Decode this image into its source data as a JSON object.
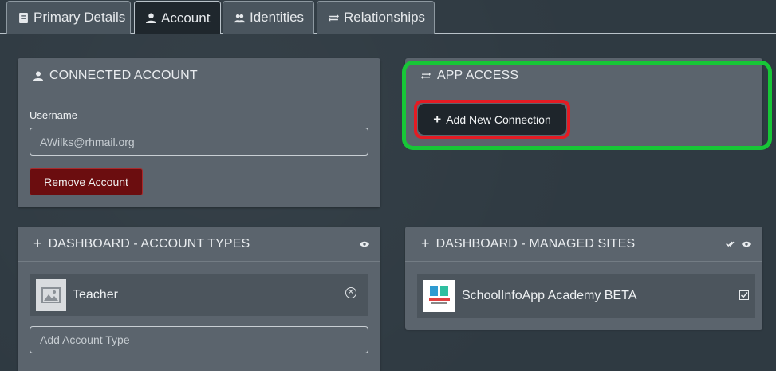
{
  "tabs": [
    {
      "label": "Primary Details",
      "icon": "document-icon"
    },
    {
      "label": "Account",
      "icon": "user-icon"
    },
    {
      "label": "Identities",
      "icon": "users-icon"
    },
    {
      "label": "Relationships",
      "icon": "swap-icon"
    }
  ],
  "connected_account": {
    "title": "CONNECTED ACCOUNT",
    "username_label": "Username",
    "username_value": "AWilks@rhmail.org",
    "remove_label": "Remove Account"
  },
  "app_access": {
    "title": "APP ACCESS",
    "add_label": "Add New Connection"
  },
  "account_types": {
    "title": "DASHBOARD - ACCOUNT TYPES",
    "items": [
      {
        "label": "Teacher"
      }
    ],
    "add_placeholder": "Add Account Type"
  },
  "managed_sites": {
    "title": "DASHBOARD - MANAGED SITES",
    "items": [
      {
        "label": "SchoolInfoApp Academy BETA"
      }
    ]
  },
  "colors": {
    "highlight_green": "#17c737",
    "highlight_red": "#e41b23",
    "danger": "#6b0d0f"
  }
}
